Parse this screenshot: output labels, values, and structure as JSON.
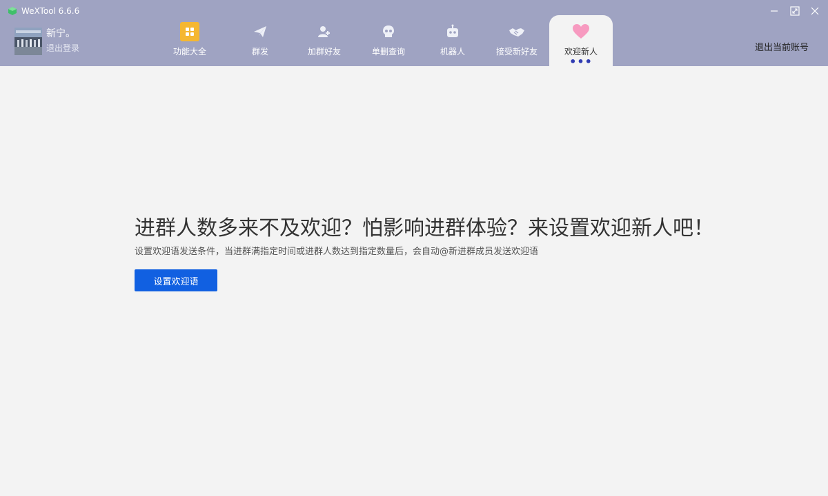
{
  "window": {
    "title": "WeXTool 6.6.6",
    "controls": [
      "minimize-icon",
      "maximize-icon",
      "close-icon"
    ]
  },
  "user": {
    "name": "新宁。",
    "logout_label": "退出登录"
  },
  "nav": {
    "items": [
      {
        "label": "功能大全",
        "icon": "grid-icon"
      },
      {
        "label": "群发",
        "icon": "paper-plane-icon"
      },
      {
        "label": "加群好友",
        "icon": "add-friend-icon"
      },
      {
        "label": "单删查询",
        "icon": "skull-icon"
      },
      {
        "label": "机器人",
        "icon": "robot-icon"
      },
      {
        "label": "接受新好友",
        "icon": "handshake-icon"
      },
      {
        "label": "欢迎新人",
        "icon": "heart-icon",
        "active": true
      }
    ],
    "more_label": "•••"
  },
  "account": {
    "logout_account_label": "退出当前账号"
  },
  "main": {
    "headline": "进群人数多来不及欢迎？怕影响进群体验？来设置欢迎新人吧！",
    "description": "设置欢迎语发送条件，当进群满指定时间或进群人数达到指定数量后，会自动@新进群成员发送欢迎语",
    "button_label": "设置欢迎语"
  },
  "colors": {
    "header_bg": "#9fa3c2",
    "page_bg": "#f3f3f3",
    "primary": "#1160e1",
    "grid_icon": "#f5b731",
    "heart_icon": "#f79ac0"
  }
}
